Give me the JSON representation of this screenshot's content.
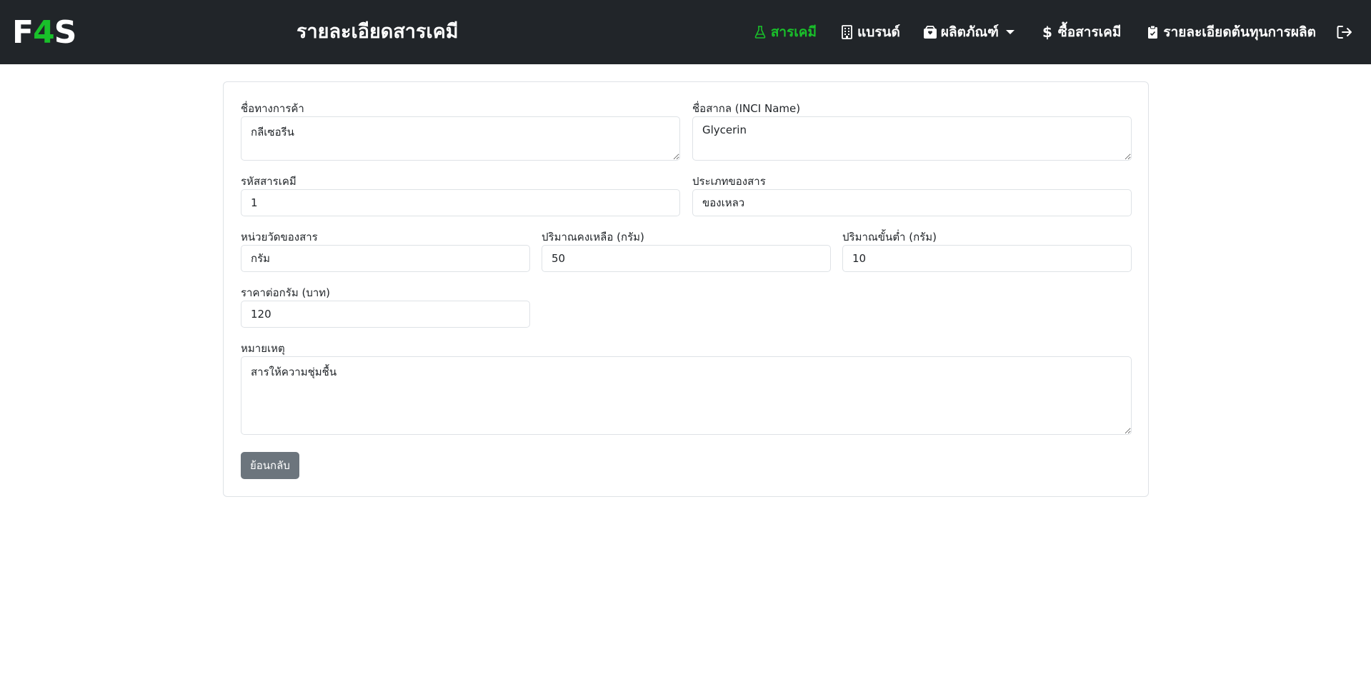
{
  "header": {
    "logo_left": "F",
    "logo_accent": "4",
    "logo_right": "S",
    "title": "รายละเอียดสารเคมี"
  },
  "nav": {
    "items": [
      {
        "label": "สารเคมี",
        "icon": "flask-icon",
        "active": true
      },
      {
        "label": "แบรนด์",
        "icon": "building-icon",
        "active": false
      },
      {
        "label": "ผลิตภัณฑ์",
        "icon": "box-icon",
        "active": false,
        "dropdown": true
      },
      {
        "label": "ซื้อสารเคมี",
        "icon": "dollar-icon",
        "active": false
      },
      {
        "label": "รายละเอียดต้นทุนการผลิต",
        "icon": "clipboard-icon",
        "active": false
      }
    ],
    "logout_icon": "logout-icon"
  },
  "form": {
    "trade_name": {
      "label": "ชื่อทางการค้า",
      "value": "กลีเซอรีน"
    },
    "inci_name": {
      "label": "ชื่อสากล (INCI Name)",
      "value": "Glycerin"
    },
    "chem_code": {
      "label": "รหัสสารเคมี",
      "value": "1"
    },
    "chem_type": {
      "label": "ประเภทของสาร",
      "value": "ของเหลว"
    },
    "unit": {
      "label": "หน่วยวัดของสาร",
      "value": "กรัม"
    },
    "remaining": {
      "label": "ปริมาณคงเหลือ (กรัม)",
      "value": "50"
    },
    "minimum": {
      "label": "ปริมาณขั้นต่ำ (กรัม)",
      "value": "10"
    },
    "price": {
      "label": "ราคาต่อกรัม (บาท)",
      "value": "120"
    },
    "note": {
      "label": "หมายเหตุ",
      "value": "สารให้ความชุ่มชื้น"
    },
    "back_label": "ย้อนกลับ"
  },
  "colors": {
    "navbar": "#212529",
    "accent": "#19c02a",
    "button": "#6c757d",
    "border": "#dee2e6"
  }
}
